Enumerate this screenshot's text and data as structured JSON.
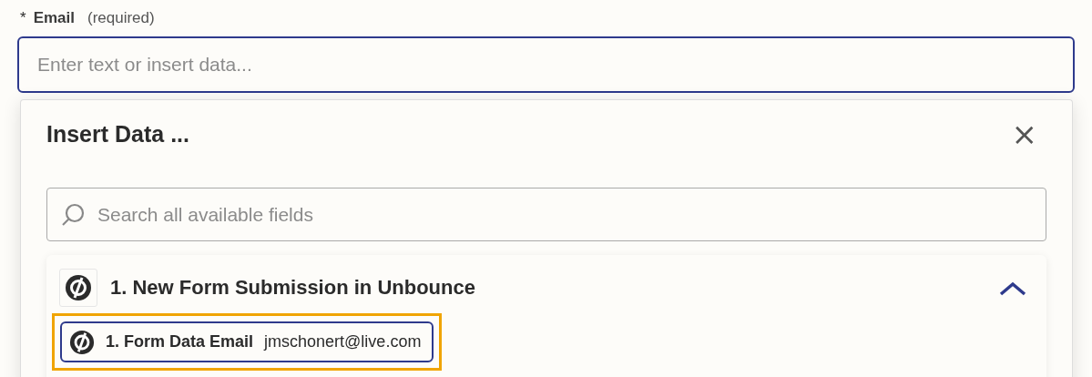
{
  "field": {
    "required_mark": "*",
    "label": "Email",
    "hint": "(required)",
    "placeholder": "Enter text or insert data...",
    "focused": true
  },
  "popover": {
    "title": "Insert Data ...",
    "close": "×",
    "search": {
      "placeholder": "Search all available fields"
    },
    "groups": [
      {
        "title": "1. New Form Submission in Unbounce",
        "expanded": true,
        "items": [
          {
            "label": "1. Form Data Email",
            "value": "jmschonert@live.com",
            "selected": true
          }
        ]
      }
    ]
  }
}
